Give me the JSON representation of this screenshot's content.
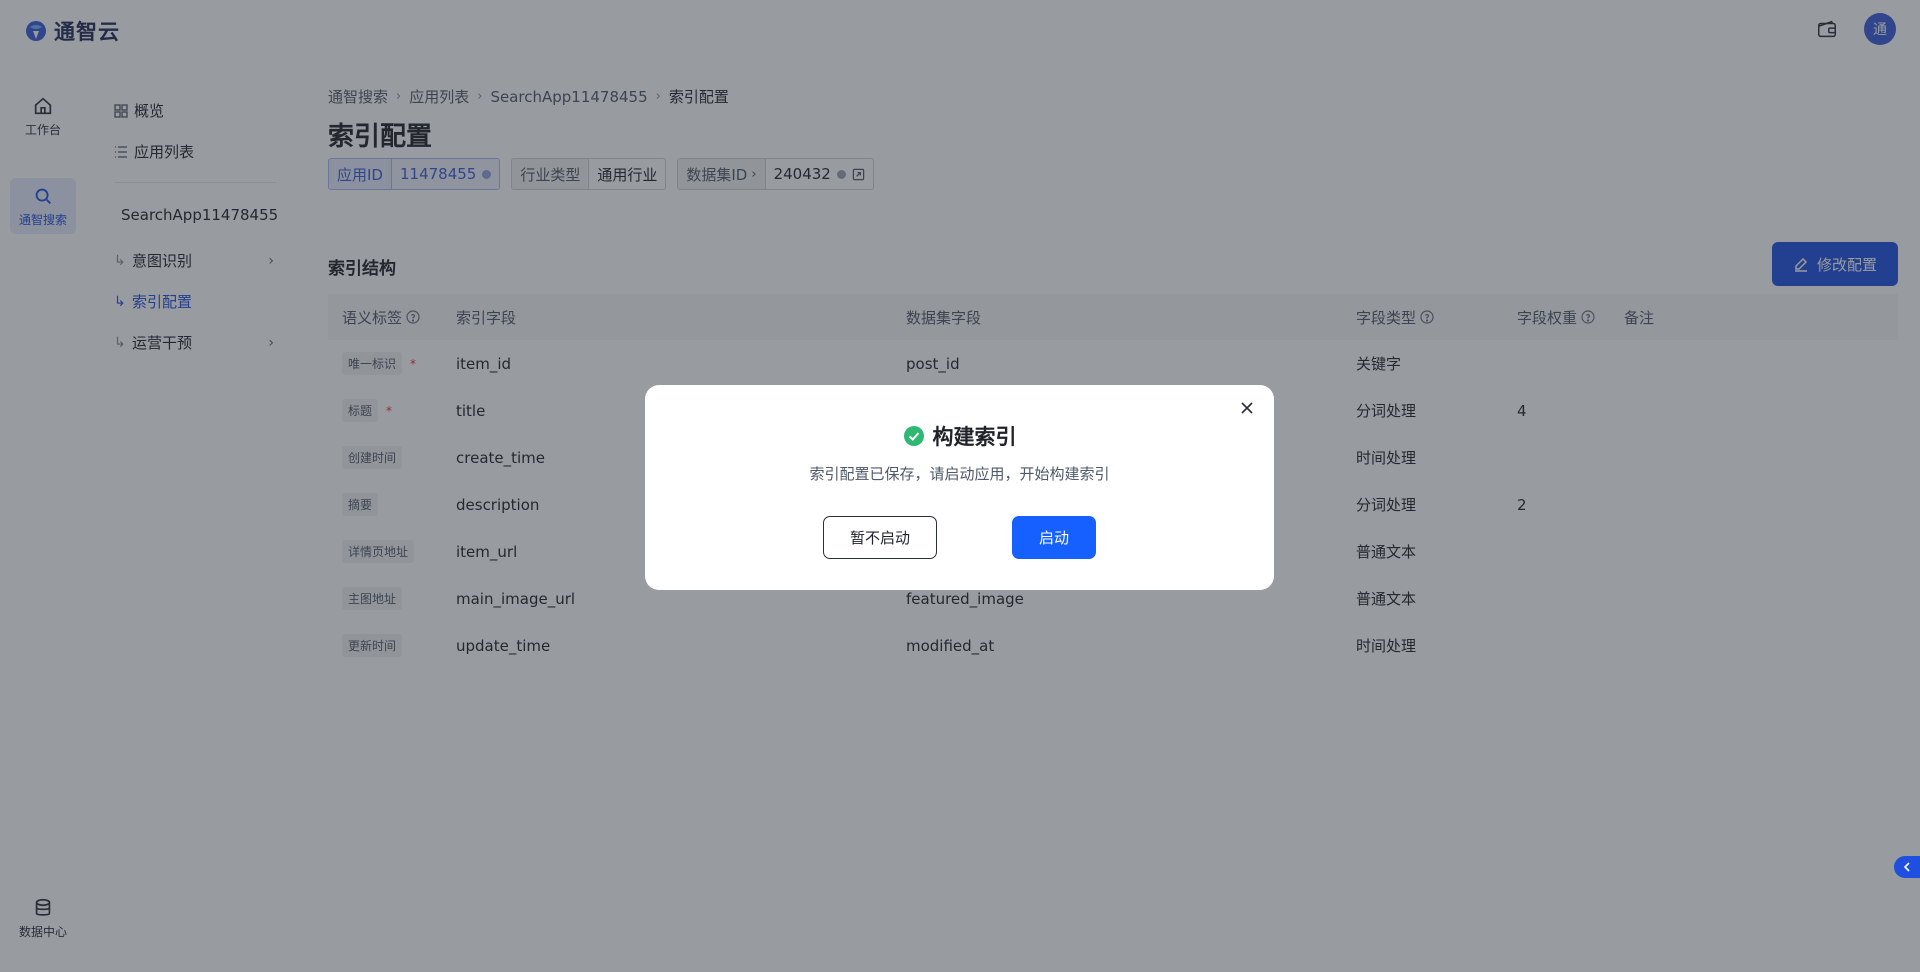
{
  "app": {
    "brand": "通智云",
    "avatar_initial": "通"
  },
  "rail": {
    "items": [
      {
        "label": "工作台",
        "icon": "home-icon"
      },
      {
        "label": "通智搜索",
        "icon": "search-icon"
      },
      {
        "label": "数据中心",
        "icon": "database-icon"
      }
    ]
  },
  "sidenav": {
    "overview": "概览",
    "app_list": "应用列表",
    "app_name": "SearchApp11478455",
    "intent": "意图识别",
    "index_config": "索引配置",
    "ops": "运营干预"
  },
  "breadcrumb": [
    "通智搜索",
    "应用列表",
    "SearchApp11478455",
    "索引配置"
  ],
  "page": {
    "title": "索引配置",
    "tags": {
      "app_id_key": "应用ID",
      "app_id_val": "11478455",
      "industry_key": "行业类型",
      "industry_val": "通用行业",
      "dataset_key": "数据集ID",
      "dataset_val": "240432"
    },
    "section_title": "索引结构",
    "edit_button": "修改配置"
  },
  "table": {
    "headers": [
      "语义标签",
      "索引字段",
      "数据集字段",
      "字段类型",
      "字段权重",
      "备注"
    ],
    "rows": [
      {
        "label": "唯一标识",
        "required": "*",
        "field": "item_id",
        "dataset": "post_id",
        "type": "关键字",
        "weight": ""
      },
      {
        "label": "标题",
        "required": "*",
        "field": "title",
        "dataset": "",
        "type": "分词处理",
        "weight": "4"
      },
      {
        "label": "创建时间",
        "required": "",
        "field": "create_time",
        "dataset": "",
        "type": "时间处理",
        "weight": ""
      },
      {
        "label": "摘要",
        "required": "",
        "field": "description",
        "dataset": "",
        "type": "分词处理",
        "weight": "2"
      },
      {
        "label": "详情页地址",
        "required": "",
        "field": "item_url",
        "dataset": "",
        "type": "普通文本",
        "weight": ""
      },
      {
        "label": "主图地址",
        "required": "",
        "field": "main_image_url",
        "dataset": "featured_image",
        "type": "普通文本",
        "weight": ""
      },
      {
        "label": "更新时间",
        "required": "",
        "field": "update_time",
        "dataset": "modified_at",
        "type": "时间处理",
        "weight": ""
      }
    ]
  },
  "modal": {
    "title": "构建索引",
    "description": "索引配置已保存，请启动应用，开始构建索引",
    "cancel": "暂不启动",
    "confirm": "启动"
  },
  "colors": {
    "accent": "#1f4fe0",
    "confirm": "#1660ff",
    "success": "#2eb872"
  }
}
